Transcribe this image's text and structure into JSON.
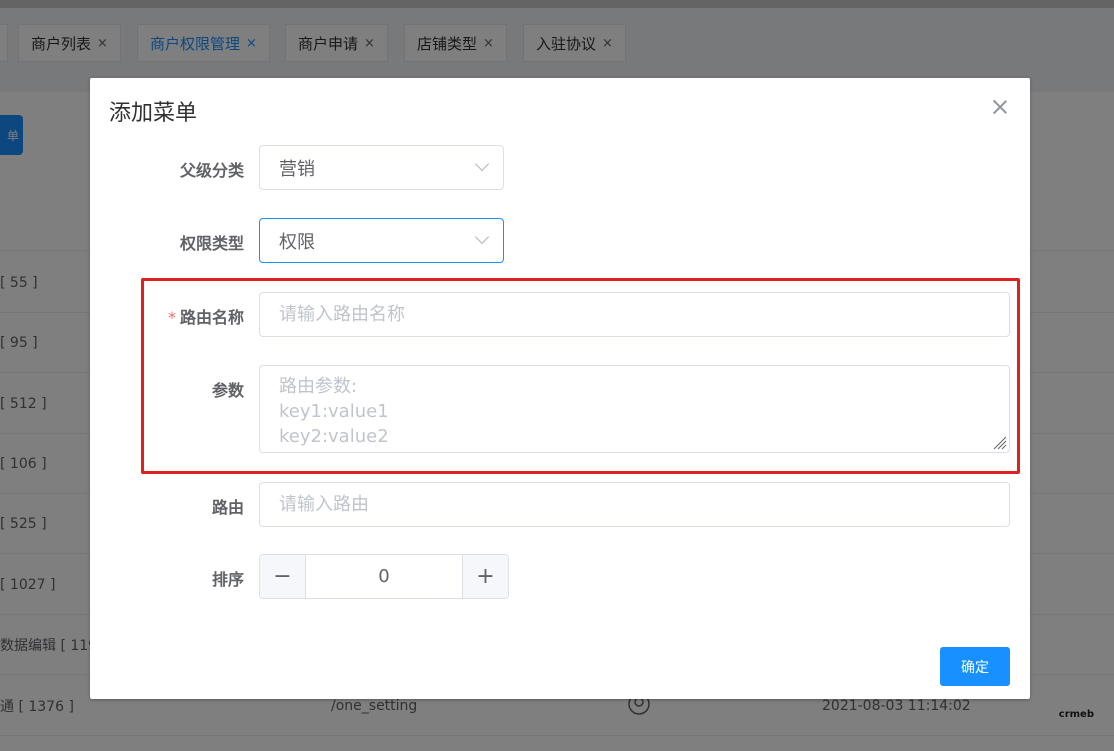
{
  "tabs": [
    {
      "label": "商户列表",
      "active": false
    },
    {
      "label": "商户权限管理",
      "active": true
    },
    {
      "label": "商户申请",
      "active": false
    },
    {
      "label": "店铺类型",
      "active": false
    },
    {
      "label": "入驻协议",
      "active": false
    }
  ],
  "tab_close_glyph": "×",
  "background": {
    "button_partial": "单",
    "rows": [
      {
        "c1": "[ 55 ]"
      },
      {
        "c1": "[ 95 ]"
      },
      {
        "c1": "[ 512 ]"
      },
      {
        "c1": "[ 106 ]"
      },
      {
        "c1": "[ 525 ]"
      },
      {
        "c1": "[ 1027 ]"
      },
      {
        "c1": "数据编辑 [ 119"
      },
      {
        "c1": "通 [ 1376 ]",
        "c2": "/one_setting",
        "c4": "2021-08-03 11:14:02"
      }
    ],
    "brand": "crmeb"
  },
  "dialog": {
    "title": "添加菜单",
    "parent_label": "父级分类",
    "parent_value": "营销",
    "type_label": "权限类型",
    "type_value": "权限",
    "required_mark": "*",
    "route_name_label": "路由名称",
    "route_name_placeholder": "请输入路由名称",
    "params_label": "参数",
    "params_placeholder_1": "路由参数:",
    "params_placeholder_2": "key1:value1",
    "params_placeholder_3": "key2:value2",
    "route_label": "路由",
    "route_placeholder": "请输入路由",
    "sort_label": "排序",
    "sort_value": "0",
    "sort_minus": "−",
    "sort_plus": "+",
    "confirm_label": "确定"
  },
  "colors": {
    "accent": "#1890ff",
    "highlight": "#e02020"
  }
}
